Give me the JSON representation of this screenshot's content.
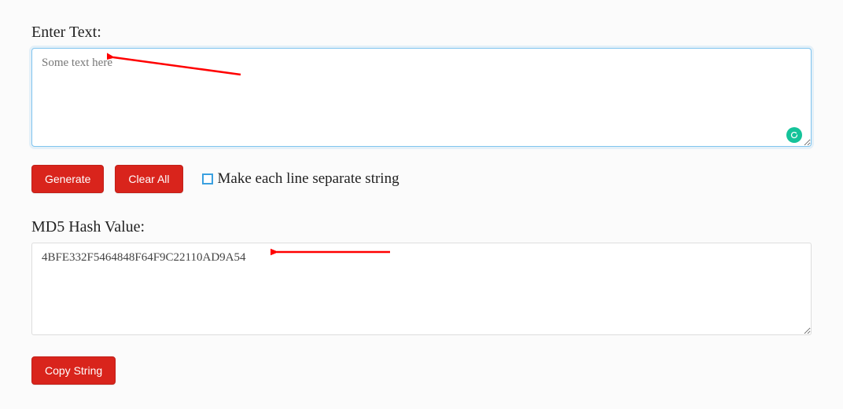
{
  "input_label": "Enter Text:",
  "input_value": "Some text here",
  "generate_label": "Generate",
  "clearall_label": "Clear All",
  "checkbox_label": "Make each line separate string",
  "output_label": "MD5 Hash Value:",
  "output_value": "4BFE332F5464848F64F9C22110AD9A54",
  "copy_label": "Copy String"
}
